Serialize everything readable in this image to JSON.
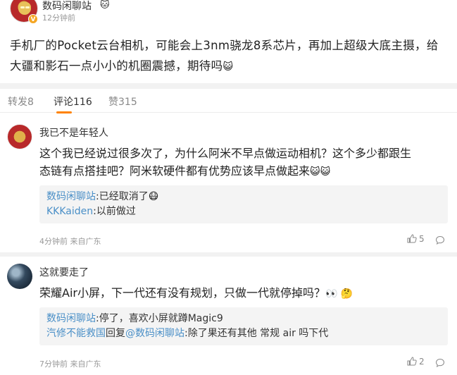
{
  "post": {
    "author": "数码闲聊站",
    "name_emoji": "🐱",
    "time": "12分钟前",
    "verified_badge": "V",
    "body_line1": "手机厂的Pocket云台相机，可能会上3nm骁龙8系芯片，再加上超级大底主摄，给",
    "body_line2": "大疆和影石一点小小的机圈震撼，期待吗",
    "body_emoji": "😺"
  },
  "tabs": [
    {
      "label": "转发8",
      "active": false
    },
    {
      "label": "评论116",
      "active": true
    },
    {
      "label": "赞315",
      "active": false
    }
  ],
  "comments": [
    {
      "author": "我已不是年轻人",
      "text_line1": "这个我已经说过很多次了，为什么阿米不早点做运动相机？这个多少都跟生",
      "text_line2": "态链有点搭挂吧？阿米软硬件都有优势应该早点做起来",
      "text_emoji": "😺😺",
      "replies": [
        {
          "user": "数码闲聊站",
          "sep": ":",
          "text": "已经取消了",
          "emoji": "😷"
        },
        {
          "user": "KKKaiden",
          "sep": ":",
          "text": "以前做过",
          "emoji": ""
        }
      ],
      "meta": "4分钟前  来自广东",
      "likes": "5"
    },
    {
      "author": "这就要走了",
      "text_line1": "荣耀Air小屏，下一代还有没有规划，只做一代就停掉吗？",
      "text_emoji": "👀 🤔",
      "replies": [
        {
          "user": "数码闲聊站",
          "sep": ":",
          "text": "停了，喜欢小屏就蹲Magic9"
        },
        {
          "user": "汽修不能救国",
          "mid": "回复",
          "target": "@数码闲聊站",
          "sep": ":",
          "text": "除了果还有其他 常规 air 吗下代"
        }
      ],
      "meta": "7分钟前  来自广东",
      "likes": "2"
    }
  ],
  "icons": {
    "like": "thumbs-up-icon",
    "more": "chat-bubble-icon"
  }
}
